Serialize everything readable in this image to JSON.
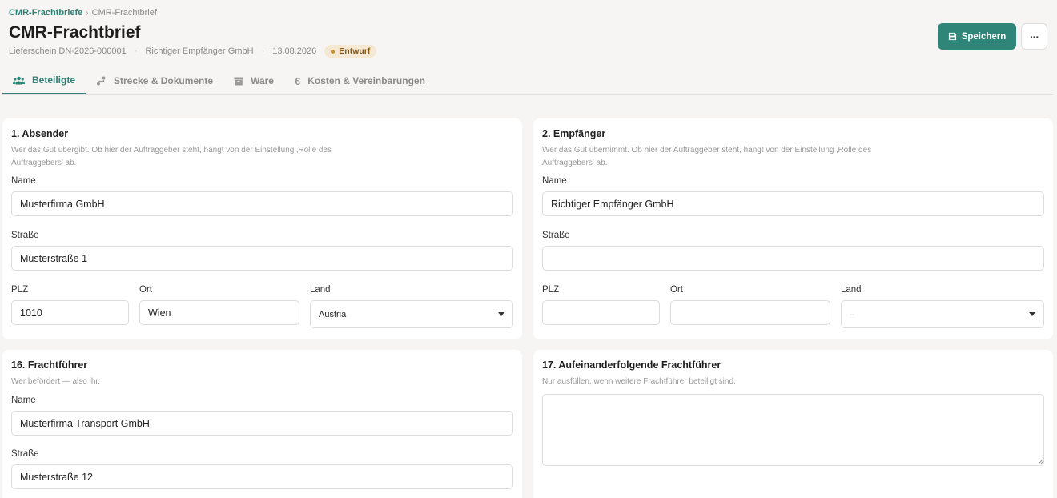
{
  "breadcrumb": {
    "parent": "CMR-Frachtbriefe",
    "separator": "›",
    "current": "CMR-Frachtbrief"
  },
  "header": {
    "title": "CMR-Frachtbrief",
    "delivery_note": "Lieferschein DN-2026-000001",
    "recipient": "Richtiger Empfänger GmbH",
    "date": "13.08.2026",
    "status": "Entwurf",
    "meta_sep": "·"
  },
  "actions": {
    "save_label": "Speichern",
    "more_label": "···"
  },
  "tabs": [
    {
      "label": "Beteiligte",
      "icon": "users-icon",
      "active": true
    },
    {
      "label": "Strecke & Dokumente",
      "icon": "route-icon",
      "active": false
    },
    {
      "label": "Ware",
      "icon": "box-icon",
      "active": false
    },
    {
      "label": "Kosten & Vereinbarungen",
      "icon": "euro-icon",
      "active": false
    }
  ],
  "sender": {
    "title": "1. Absender",
    "desc": "Wer das Gut übergibt. Ob hier der Auftraggeber steht, hängt von der Einstellung ‚Rolle des Auftraggebers' ab.",
    "name_label": "Name",
    "name_value": "Musterfirma GmbH",
    "street_label": "Straße",
    "street_value": "Musterstraße 1",
    "zip_label": "PLZ",
    "zip_value": "1010",
    "city_label": "Ort",
    "city_value": "Wien",
    "country_label": "Land",
    "country_value": "Austria"
  },
  "recipient": {
    "title": "2. Empfänger",
    "desc": "Wer das Gut übernimmt. Ob hier der Auftraggeber steht, hängt von der Einstellung ‚Rolle des Auftraggebers' ab.",
    "name_label": "Name",
    "name_value": "Richtiger Empfänger GmbH",
    "street_label": "Straße",
    "street_value": "",
    "zip_label": "PLZ",
    "zip_value": "",
    "city_label": "Ort",
    "city_value": "",
    "country_label": "Land",
    "country_value": "–"
  },
  "carrier": {
    "title": "16. Frachtführer",
    "desc": "Wer befördert — also ihr.",
    "name_label": "Name",
    "name_value": "Musterfirma Transport GmbH",
    "street_label": "Straße",
    "street_value": "Musterstraße 12"
  },
  "successive_carriers": {
    "title": "17. Aufeinanderfolgende Frachtführer",
    "desc": "Nur ausfüllen, wenn weitere Frachtführer beteiligt sind.",
    "value": ""
  },
  "colors": {
    "accent": "#2f8577",
    "badge_bg": "#f5e9d3",
    "badge_text": "#8b5a16",
    "background": "#f6f5f3"
  }
}
